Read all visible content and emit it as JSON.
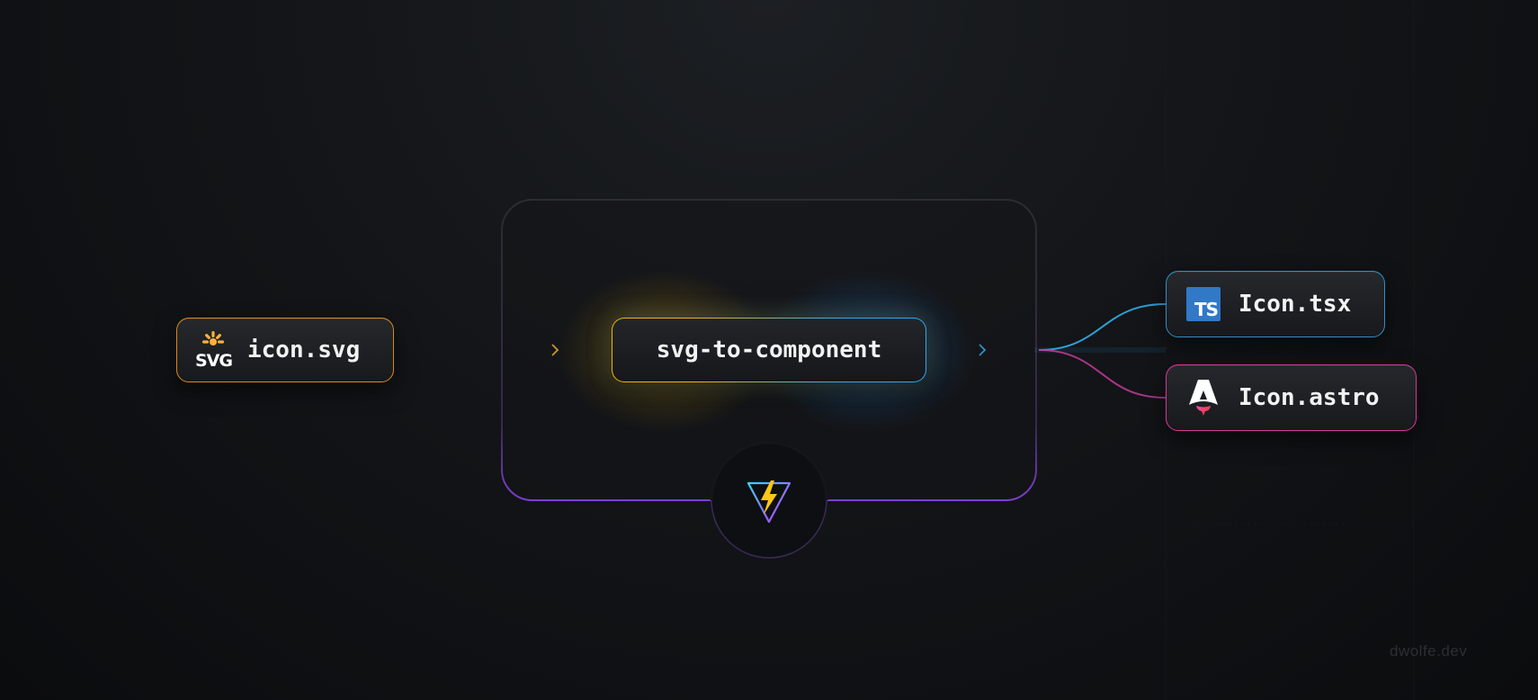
{
  "nodes": {
    "input": {
      "label": "icon.svg",
      "icon": "svg-logo-icon",
      "icon_text": "SVG",
      "color": "#d98a1c"
    },
    "center": {
      "label": "svg-to-component",
      "color_left": "#f4b400",
      "color_right": "#2aa8ff"
    },
    "output_tsx": {
      "label": "Icon.tsx",
      "icon": "typescript-icon",
      "icon_text": "TS",
      "color": "#2e8fc9"
    },
    "output_astro": {
      "label": "Icon.astro",
      "icon": "astro-icon",
      "color": "#d9359b"
    }
  },
  "plugin": {
    "icon": "vite-icon",
    "color": "#8b3fd9"
  },
  "watermark": "dwolfe.dev"
}
